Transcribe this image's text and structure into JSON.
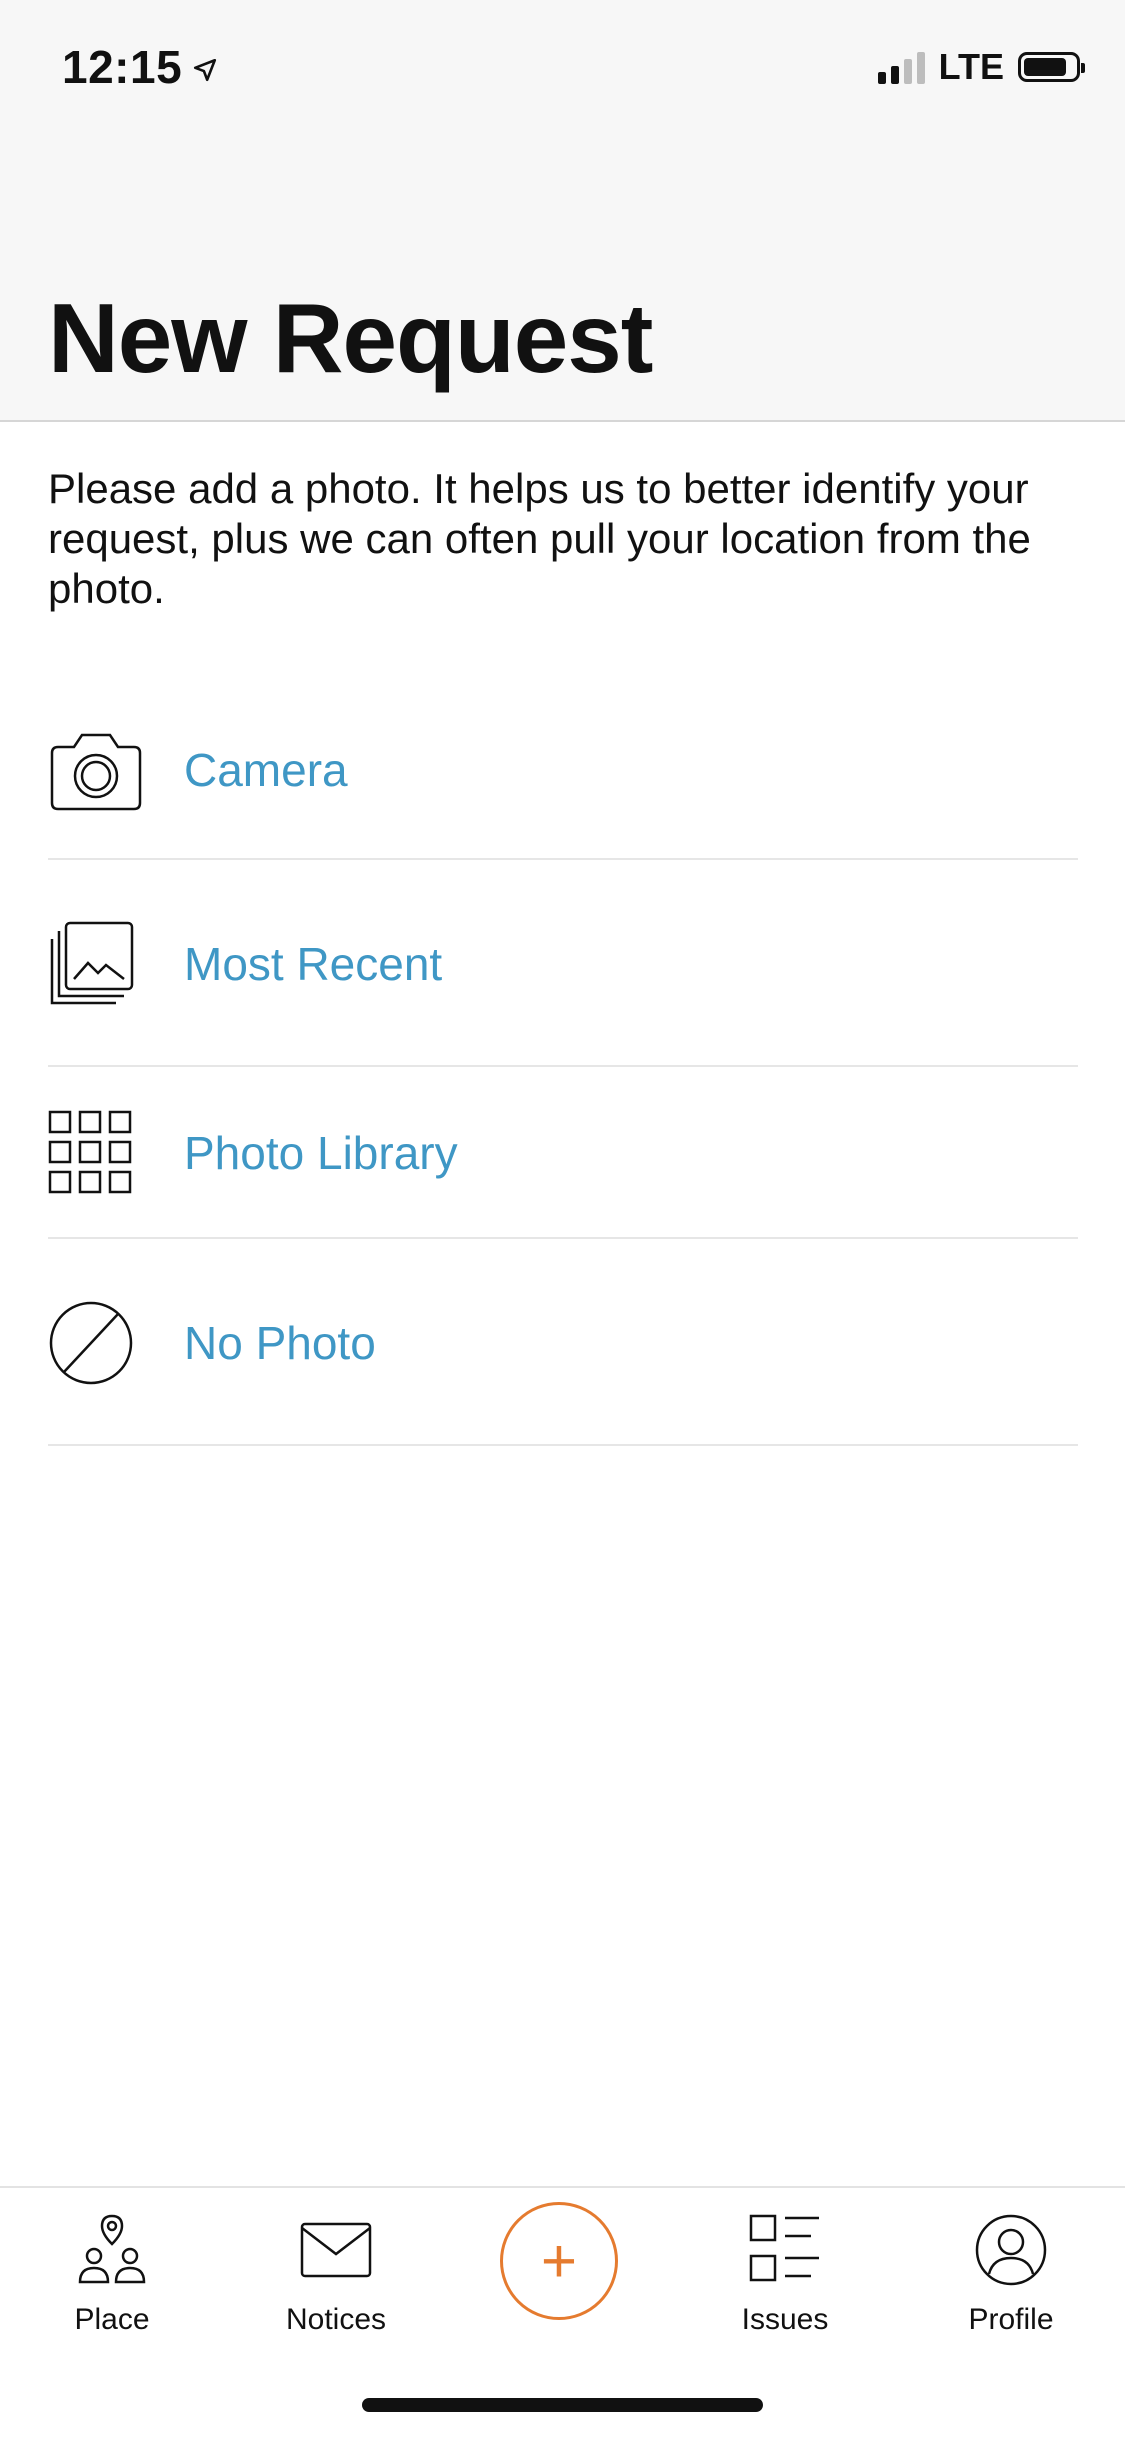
{
  "status_bar": {
    "time": "12:15",
    "carrier": "LTE"
  },
  "header": {
    "title": "New Request"
  },
  "intro": {
    "text": "Please add a photo. It helps us to better identify your request, plus we can often pull your location from the photo."
  },
  "options": [
    {
      "label": "Camera",
      "icon": "camera-icon"
    },
    {
      "label": "Most Recent",
      "icon": "photos-stack-icon"
    },
    {
      "label": "Photo Library",
      "icon": "grid-icon"
    },
    {
      "label": "No Photo",
      "icon": "no-photo-icon"
    }
  ],
  "tabbar": {
    "place": "Place",
    "notices": "Notices",
    "add_symbol": "+",
    "issues": "Issues",
    "profile": "Profile"
  },
  "colors": {
    "accent": "#3f97c5",
    "add_button": "#e57b2f",
    "header_bg": "#f7f7f7"
  }
}
